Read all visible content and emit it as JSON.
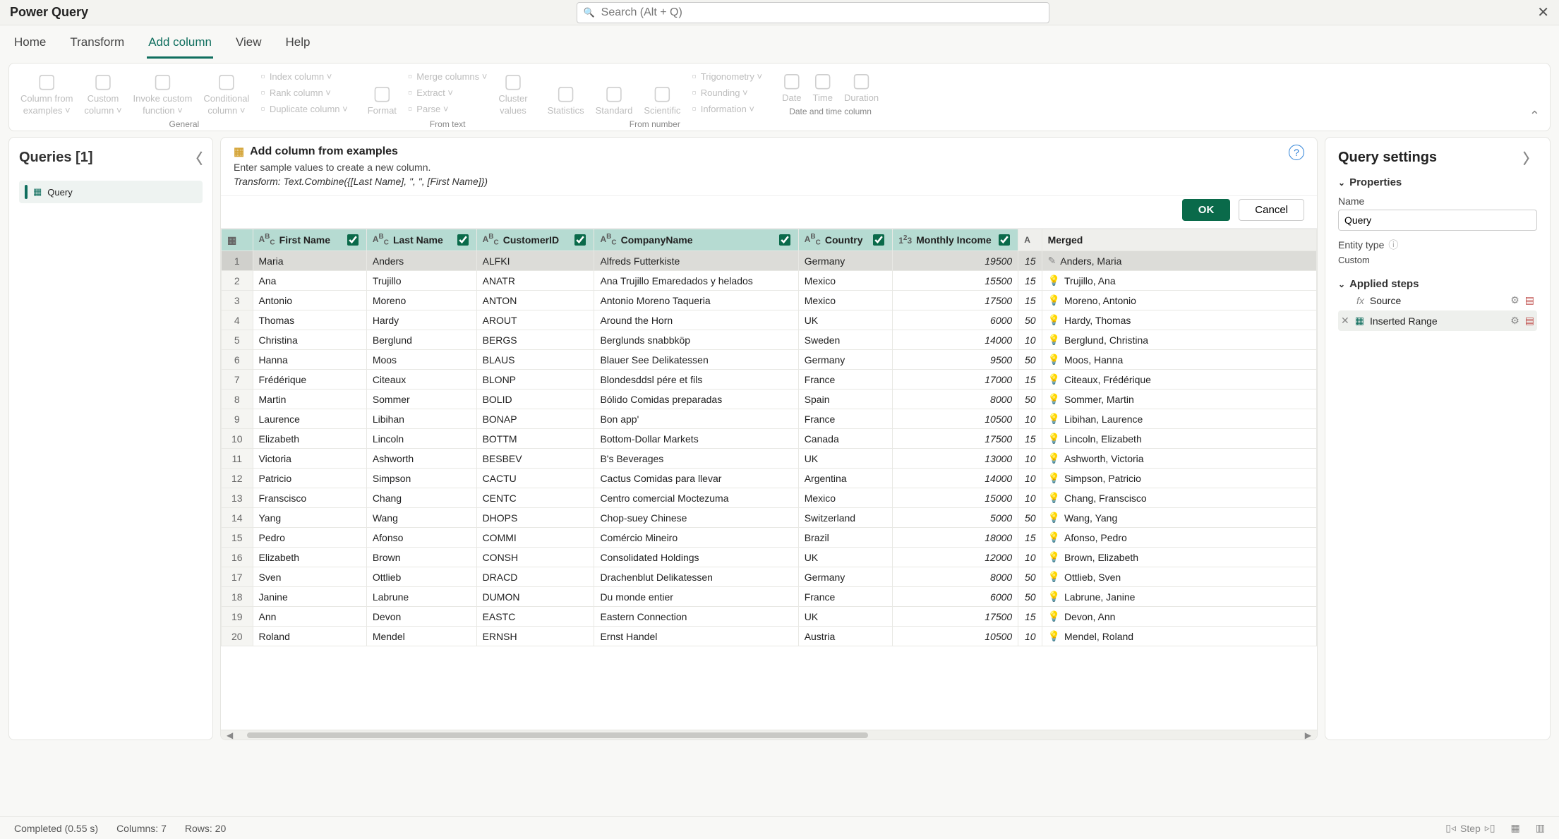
{
  "app": {
    "title": "Power Query"
  },
  "search": {
    "placeholder": "Search (Alt + Q)"
  },
  "tabs": [
    "Home",
    "Transform",
    "Add column",
    "View",
    "Help"
  ],
  "activeTab": "Add column",
  "ribbon": {
    "groups": [
      {
        "label": "General",
        "big": [
          {
            "l1": "Column from",
            "l2": "examples"
          },
          {
            "l1": "Custom",
            "l2": "column"
          },
          {
            "l1": "Invoke custom",
            "l2": "function"
          },
          {
            "l1": "Conditional",
            "l2": "column"
          }
        ],
        "small": [
          "Index column",
          "Rank column",
          "Duplicate column"
        ]
      },
      {
        "label": "From text",
        "big": [
          {
            "l1": "Format",
            "l2": ""
          }
        ],
        "small": [
          "Merge columns",
          "Extract",
          "Parse"
        ],
        "extraBig": [
          {
            "l1": "Cluster",
            "l2": "values"
          }
        ]
      },
      {
        "label": "From number",
        "big": [
          {
            "l1": "Statistics",
            "l2": ""
          },
          {
            "l1": "Standard",
            "l2": ""
          },
          {
            "l1": "Scientific",
            "l2": ""
          }
        ],
        "small": [
          "Trigonometry",
          "Rounding",
          "Information"
        ]
      },
      {
        "label": "Date and time column",
        "big": [
          {
            "l1": "Date",
            "l2": ""
          },
          {
            "l1": "Time",
            "l2": ""
          },
          {
            "l1": "Duration",
            "l2": ""
          }
        ]
      }
    ]
  },
  "queriesPanel": {
    "title": "Queries [1]",
    "items": [
      "Query"
    ]
  },
  "exampleBar": {
    "title": "Add column from examples",
    "subtitle": "Enter sample values to create a new column.",
    "transform": "Transform: Text.Combine({[Last Name], \", \", [First Name]})",
    "ok": "OK",
    "cancel": "Cancel"
  },
  "columns": [
    "First Name",
    "Last Name",
    "CustomerID",
    "CompanyName",
    "Country",
    "Monthly Income",
    "Merged"
  ],
  "rows": [
    {
      "fn": "Maria",
      "ln": "Anders",
      "cid": "ALFKI",
      "comp": "Alfreds Futterkiste",
      "ctry": "Germany",
      "inc": "19500",
      "exp": "15",
      "merged": "Anders, Maria"
    },
    {
      "fn": "Ana",
      "ln": "Trujillo",
      "cid": "ANATR",
      "comp": "Ana Trujillo Emaredados y helados",
      "ctry": "Mexico",
      "inc": "15500",
      "exp": "15",
      "merged": "Trujillo, Ana"
    },
    {
      "fn": "Antonio",
      "ln": "Moreno",
      "cid": "ANTON",
      "comp": "Antonio Moreno Taqueria",
      "ctry": "Mexico",
      "inc": "17500",
      "exp": "15",
      "merged": "Moreno, Antonio"
    },
    {
      "fn": "Thomas",
      "ln": "Hardy",
      "cid": "AROUT",
      "comp": "Around the Horn",
      "ctry": "UK",
      "inc": "6000",
      "exp": "50",
      "merged": "Hardy, Thomas"
    },
    {
      "fn": "Christina",
      "ln": "Berglund",
      "cid": "BERGS",
      "comp": "Berglunds snabbköp",
      "ctry": "Sweden",
      "inc": "14000",
      "exp": "10",
      "merged": "Berglund, Christina"
    },
    {
      "fn": "Hanna",
      "ln": "Moos",
      "cid": "BLAUS",
      "comp": "Blauer See Delikatessen",
      "ctry": "Germany",
      "inc": "9500",
      "exp": "50",
      "merged": "Moos, Hanna"
    },
    {
      "fn": "Frédérique",
      "ln": "Citeaux",
      "cid": "BLONP",
      "comp": "Blondesddsl pére et fils",
      "ctry": "France",
      "inc": "17000",
      "exp": "15",
      "merged": "Citeaux, Frédérique"
    },
    {
      "fn": "Martin",
      "ln": "Sommer",
      "cid": "BOLID",
      "comp": "Bólido Comidas preparadas",
      "ctry": "Spain",
      "inc": "8000",
      "exp": "50",
      "merged": "Sommer, Martin"
    },
    {
      "fn": "Laurence",
      "ln": "Libihan",
      "cid": "BONAP",
      "comp": "Bon app'",
      "ctry": "France",
      "inc": "10500",
      "exp": "10",
      "merged": "Libihan, Laurence"
    },
    {
      "fn": "Elizabeth",
      "ln": "Lincoln",
      "cid": "BOTTM",
      "comp": "Bottom-Dollar Markets",
      "ctry": "Canada",
      "inc": "17500",
      "exp": "15",
      "merged": "Lincoln, Elizabeth"
    },
    {
      "fn": "Victoria",
      "ln": "Ashworth",
      "cid": "BESBEV",
      "comp": "B's Beverages",
      "ctry": "UK",
      "inc": "13000",
      "exp": "10",
      "merged": "Ashworth, Victoria"
    },
    {
      "fn": "Patricio",
      "ln": "Simpson",
      "cid": "CACTU",
      "comp": "Cactus Comidas para llevar",
      "ctry": "Argentina",
      "inc": "14000",
      "exp": "10",
      "merged": "Simpson, Patricio"
    },
    {
      "fn": "Franscisco",
      "ln": "Chang",
      "cid": "CENTC",
      "comp": "Centro comercial Moctezuma",
      "ctry": "Mexico",
      "inc": "15000",
      "exp": "10",
      "merged": "Chang, Franscisco"
    },
    {
      "fn": "Yang",
      "ln": "Wang",
      "cid": "DHOPS",
      "comp": "Chop-suey Chinese",
      "ctry": "Switzerland",
      "inc": "5000",
      "exp": "50",
      "merged": "Wang, Yang"
    },
    {
      "fn": "Pedro",
      "ln": "Afonso",
      "cid": "COMMI",
      "comp": "Comércio Mineiro",
      "ctry": "Brazil",
      "inc": "18000",
      "exp": "15",
      "merged": "Afonso, Pedro"
    },
    {
      "fn": "Elizabeth",
      "ln": "Brown",
      "cid": "CONSH",
      "comp": "Consolidated Holdings",
      "ctry": "UK",
      "inc": "12000",
      "exp": "10",
      "merged": "Brown, Elizabeth"
    },
    {
      "fn": "Sven",
      "ln": "Ottlieb",
      "cid": "DRACD",
      "comp": "Drachenblut Delikatessen",
      "ctry": "Germany",
      "inc": "8000",
      "exp": "50",
      "merged": "Ottlieb, Sven"
    },
    {
      "fn": "Janine",
      "ln": "Labrune",
      "cid": "DUMON",
      "comp": "Du monde entier",
      "ctry": "France",
      "inc": "6000",
      "exp": "50",
      "merged": "Labrune, Janine"
    },
    {
      "fn": "Ann",
      "ln": "Devon",
      "cid": "EASTC",
      "comp": "Eastern Connection",
      "ctry": "UK",
      "inc": "17500",
      "exp": "15",
      "merged": "Devon, Ann"
    },
    {
      "fn": "Roland",
      "ln": "Mendel",
      "cid": "ERNSH",
      "comp": "Ernst Handel",
      "ctry": "Austria",
      "inc": "10500",
      "exp": "10",
      "merged": "Mendel, Roland"
    }
  ],
  "settings": {
    "title": "Query settings",
    "propsLabel": "Properties",
    "nameLabel": "Name",
    "nameValue": "Query",
    "entityLabel": "Entity type",
    "entityValue": "Custom",
    "stepsLabel": "Applied steps",
    "steps": [
      {
        "name": "Source",
        "icon": "fx"
      },
      {
        "name": "Inserted Range",
        "icon": "table",
        "selected": true
      }
    ]
  },
  "status": {
    "completed": "Completed (0.55 s)",
    "cols": "Columns: 7",
    "rows": "Rows: 20",
    "step": "Step"
  }
}
